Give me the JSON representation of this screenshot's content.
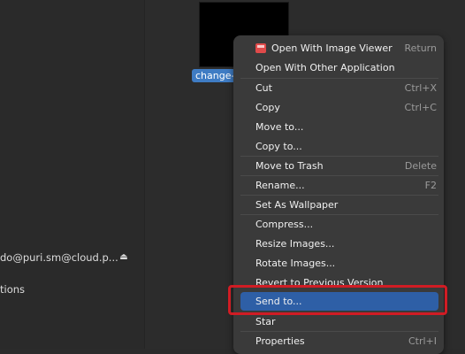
{
  "sidebar": {
    "account_label": "do@puri.sm@cloud.p...",
    "other_label": "tions"
  },
  "file": {
    "name": "change-"
  },
  "context_menu": {
    "items": [
      {
        "label": "Open With Image Viewer",
        "accel": "Return",
        "icon": "image-viewer-icon"
      },
      {
        "label": "Open With Other Application",
        "accel": ""
      },
      {
        "label": "Cut",
        "accel": "Ctrl+X"
      },
      {
        "label": "Copy",
        "accel": "Ctrl+C"
      },
      {
        "label": "Move to...",
        "accel": ""
      },
      {
        "label": "Copy to...",
        "accel": ""
      },
      {
        "label": "Move to Trash",
        "accel": "Delete"
      },
      {
        "label": "Rename...",
        "accel": "F2"
      },
      {
        "label": "Set As Wallpaper",
        "accel": ""
      },
      {
        "label": "Compress...",
        "accel": ""
      },
      {
        "label": "Resize Images...",
        "accel": ""
      },
      {
        "label": "Rotate Images...",
        "accel": ""
      },
      {
        "label": "Revert to Previous Version",
        "accel": ""
      },
      {
        "label": "Send to...",
        "accel": "",
        "selected": true
      },
      {
        "label": "Star",
        "accel": ""
      },
      {
        "label": "Properties",
        "accel": "Ctrl+I"
      }
    ]
  },
  "colors": {
    "highlight_border": "#d01c24",
    "selected_bg": "#2e5fa6"
  }
}
